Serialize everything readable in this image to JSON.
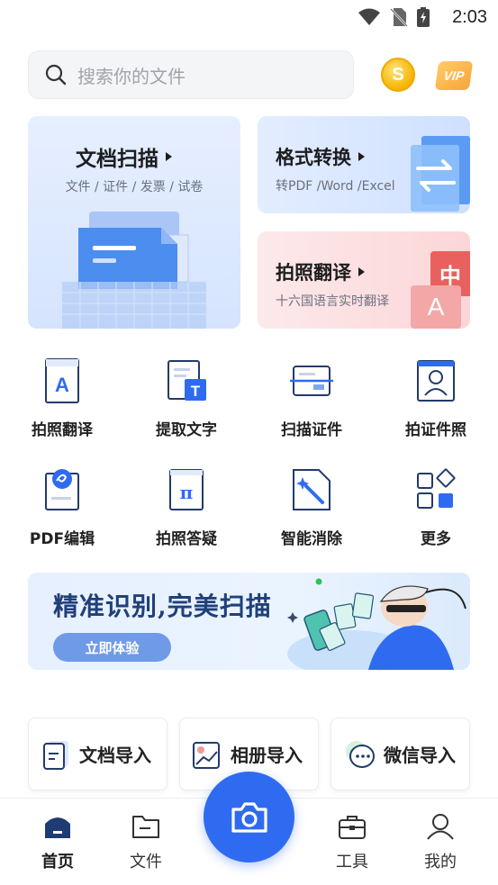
{
  "status_bar": {
    "time": "2:03"
  },
  "search": {
    "placeholder": "搜索你的文件"
  },
  "header": {
    "coin_symbol": "S",
    "vip_label": "VIP"
  },
  "cards": {
    "scan": {
      "title": "文档扫描",
      "subtitle": "文件 / 证件 / 发票 / 试卷"
    },
    "format": {
      "title": "格式转换",
      "subtitle": "转PDF /Word /Excel"
    },
    "photo_translate": {
      "title": "拍照翻译",
      "subtitle": "十六国语言实时翻译",
      "badge_zh": "中",
      "badge_a": "A"
    }
  },
  "tools": [
    {
      "label": "拍照翻译",
      "icon": "translate-doc-icon"
    },
    {
      "label": "提取文字",
      "icon": "extract-text-icon"
    },
    {
      "label": "扫描证件",
      "icon": "id-card-scan-icon"
    },
    {
      "label": "拍证件照",
      "icon": "id-photo-icon"
    },
    {
      "label": "PDF编辑",
      "icon": "pdf-edit-icon"
    },
    {
      "label": "拍照答疑",
      "icon": "math-answer-icon"
    },
    {
      "label": "智能消除",
      "icon": "magic-erase-icon"
    },
    {
      "label": "更多",
      "icon": "more-grid-icon"
    }
  ],
  "banner": {
    "headline": "精准识别,完美扫描",
    "cta": "立即体验"
  },
  "imports": [
    {
      "label": "文档导入",
      "icon": "document-import-icon"
    },
    {
      "label": "相册导入",
      "icon": "album-import-icon"
    },
    {
      "label": "微信导入",
      "icon": "wechat-import-icon"
    }
  ],
  "bottom_nav": [
    {
      "label": "首页",
      "icon": "home-icon",
      "active": true
    },
    {
      "label": "文件",
      "icon": "folder-icon",
      "active": false
    },
    {
      "label": "工具",
      "icon": "toolbox-icon",
      "active": false
    },
    {
      "label": "我的",
      "icon": "profile-icon",
      "active": false
    }
  ],
  "colors": {
    "accent": "#2f6bf0",
    "banner_text": "#20407a",
    "cta": "#6f9ae8"
  }
}
